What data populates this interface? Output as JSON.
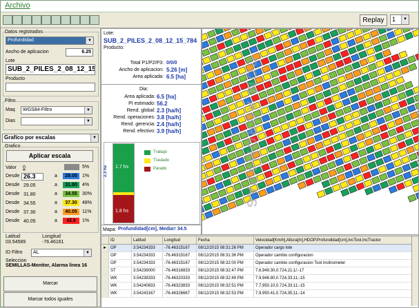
{
  "title": "Archivo",
  "toolbar": {
    "replay_label": "Replay",
    "replay_value": "1"
  },
  "left": {
    "datos_label": "Datos registrados",
    "datos_value": "Profundidad",
    "ancho_label": "Ancho de aplicacion",
    "ancho_value": "6.25",
    "lote_label": "Lote",
    "lote_value": "SUB_2_PILES_2_08_12_15_",
    "producto_label": "Producto",
    "filtro_label": "Filtro",
    "maq_label": "Maq",
    "maq_value": "WGS84-Filtro",
    "dias_label": "Dias",
    "grafico_value": "Grafico por escalas",
    "grafico_group_label": "Grafico",
    "aplicar_label": "Aplicar escala",
    "valor_label": "Valor",
    "valor_value": "0",
    "desde_label": "Desde",
    "a_label": "a",
    "scale": [
      {
        "from": "26.3",
        "to": "28.05",
        "pct": "1%",
        "color": "#2b7be0"
      },
      {
        "from": "29.05",
        "to": "31.80",
        "pct": "4%",
        "color": "#16a05a"
      },
      {
        "from": "31.80",
        "to": "34.55",
        "pct": "30%",
        "color": "#7ac142"
      },
      {
        "from": "34.55",
        "to": "37.30",
        "pct": "48%",
        "color": "#ffe81a"
      },
      {
        "from": "37.30",
        "to": "40.05",
        "pct": "11%",
        "color": "#ff9d1c"
      },
      {
        "from": "40.05",
        "to": "42.8",
        "pct": "1%",
        "color": "#ff2020"
      }
    ],
    "top_pct": "5%",
    "latitud_label": "Latitud",
    "latitud_value": "03.54589",
    "longitud_label": "Longitud",
    "longitud_value": "-76.46161",
    "idfiltro_label": "ID Filtro",
    "idfiltro_value": "AL",
    "seleccion_label": "Seleccion",
    "seleccion_value": "SEMILLAS-Monitor, Alarma linea 16",
    "marcar_label": "Marcar",
    "marcar_todos_label": "Marcar todos iguales"
  },
  "info": {
    "lote_label": "Lote:",
    "lote_value": "SUB_2_PILES_2_08_12_15_784",
    "producto_label": "Producto:",
    "total_label": "Total P1/P2/P3:",
    "total_value": "0/0/0",
    "ancho_label": "Ancho de aplicacion:",
    "ancho_value": "5.26 [m]",
    "area_label": "Area aplicada:",
    "area_value": "6.5 [ha]",
    "dia_label": "Dia:",
    "rows": [
      {
        "label": "Area aplicada:",
        "value": "6.5 [ha]"
      },
      {
        "label": "PI estimado:",
        "value": "56.2"
      },
      {
        "label": "Rend. global:",
        "value": "2.3 [ha/h]"
      },
      {
        "label": "Rend. operaciones:",
        "value": "3.8 [ha/h]"
      },
      {
        "label": "Rend. gerencia:",
        "value": "2.4 [ha/h]"
      },
      {
        "label": "Rend. efectivo:",
        "value": "3.9 [ha/h]"
      }
    ],
    "legend": [
      {
        "label": "Trabajo",
        "color": "#1aa04a"
      },
      {
        "label": "Traslado",
        "color": "#ffe81a"
      },
      {
        "label": "Parado",
        "color": "#a4161a"
      }
    ],
    "bar_side": "2.3 ha",
    "bar_top": "1.7 hs",
    "bar_bottom": "1.8 hs",
    "watermark": "COM AGROMAPAS",
    "mapa_label": "Mapa:",
    "mapa_value": "Profundidad[cm], Media= 34.5"
  },
  "grid": {
    "headers": [
      "ID",
      "Latitud",
      "Longitud",
      "Fecha",
      "Velocidad[Km/h],Altura[m],HDOP,Profundidad[cm],IncTool,IncTractor"
    ],
    "rows": [
      [
        "OP",
        "3.54234333",
        "-76.46315167",
        "08/12/2015 08:31:26 PM",
        "Operador cargo lote"
      ],
      [
        "OP",
        "3.54234333",
        "-76.46315167",
        "08/12/2015 08:31:36 PM",
        "Operador cambio configuracion"
      ],
      [
        "OP",
        "3.54234333",
        "-76.46315167",
        "08/12/2015 08:32:00 PM",
        "Operador cambio configuracion Tool inclinometer"
      ],
      [
        "ST",
        "3.54236000",
        "-76.46316833",
        "08/12/2015 08:32:47 PM",
        "7.6,949.30,0.724,21;1/;-17"
      ],
      [
        "WK",
        "3.54238333",
        "-76.46320333",
        "08/12/2015 08:32:49 PM",
        "7.9,948.80,0.724,33;11;-15"
      ],
      [
        "WK",
        "3.54240833",
        "-76.46323833",
        "08/12/2015 08:32:51 PM",
        "7.7,950.10,0.724,33;11;-15"
      ],
      [
        "WK",
        "3.54243167",
        "-76.46326667",
        "08/12/2015 08:32:53 PM",
        "7.9,950.41,0.724,35;11;-14"
      ]
    ]
  }
}
